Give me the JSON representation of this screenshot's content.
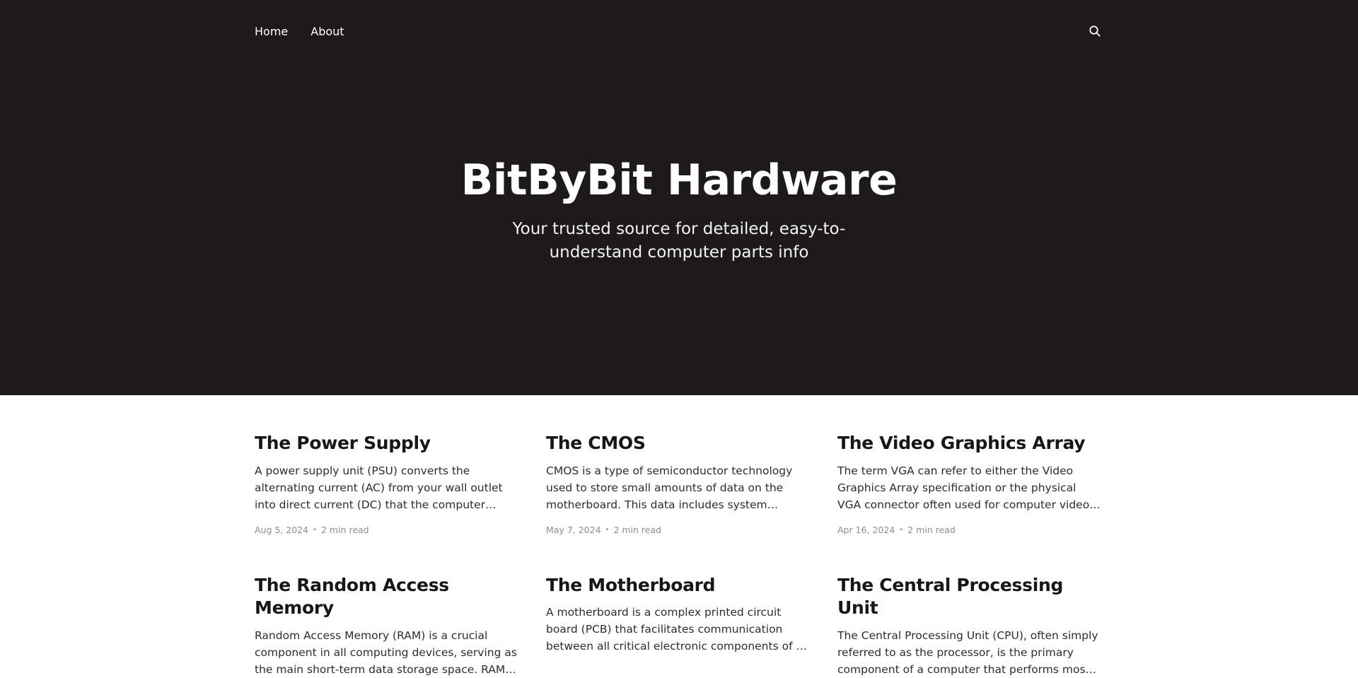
{
  "nav": {
    "items": [
      {
        "label": "Home"
      },
      {
        "label": "About"
      }
    ],
    "search_icon": "search-icon"
  },
  "hero": {
    "title": "BitByBit Hardware",
    "description": "Your trusted source for detailed, easy-to-understand computer parts info"
  },
  "colors": {
    "hero_background": "#1e1a1b",
    "page_background": "#ffffff",
    "meta_text": "#8a8d92"
  },
  "posts": [
    {
      "title": "The Power Supply",
      "excerpt": "A power supply unit (PSU) converts the alternating current (AC) from your wall outlet into direct current (DC) that the computer components require. It…",
      "date": "Aug 5, 2024",
      "read_time": "2 min read"
    },
    {
      "title": "The CMOS",
      "excerpt": "CMOS is a type of semiconductor technology used to store small amounts of data on the motherboard. This data includes system settings and configurati…",
      "date": "May 7, 2024",
      "read_time": "2 min read"
    },
    {
      "title": "The Video Graphics Array",
      "excerpt": "The term VGA can refer to either the Video Graphics Array specification or the physical VGA connector often used for computer video output. Below, I'll…",
      "date": "Apr 16, 2024",
      "read_time": "2 min read"
    },
    {
      "title": "The Random Access Memory",
      "excerpt": "Random Access Memory (RAM) is a crucial component in all computing devices, serving as the main short-term data storage space. RAM stores t…",
      "date": "",
      "read_time": ""
    },
    {
      "title": "The Motherboard",
      "excerpt": "A motherboard is a complex printed circuit board (PCB) that facilitates communication between all critical electronic components of a computer…",
      "date": "",
      "read_time": ""
    },
    {
      "title": "The Central Processing Unit",
      "excerpt": "The Central Processing Unit (CPU), often simply referred to as the processor, is the primary component of a computer that performs most of t…",
      "date": "",
      "read_time": ""
    }
  ]
}
